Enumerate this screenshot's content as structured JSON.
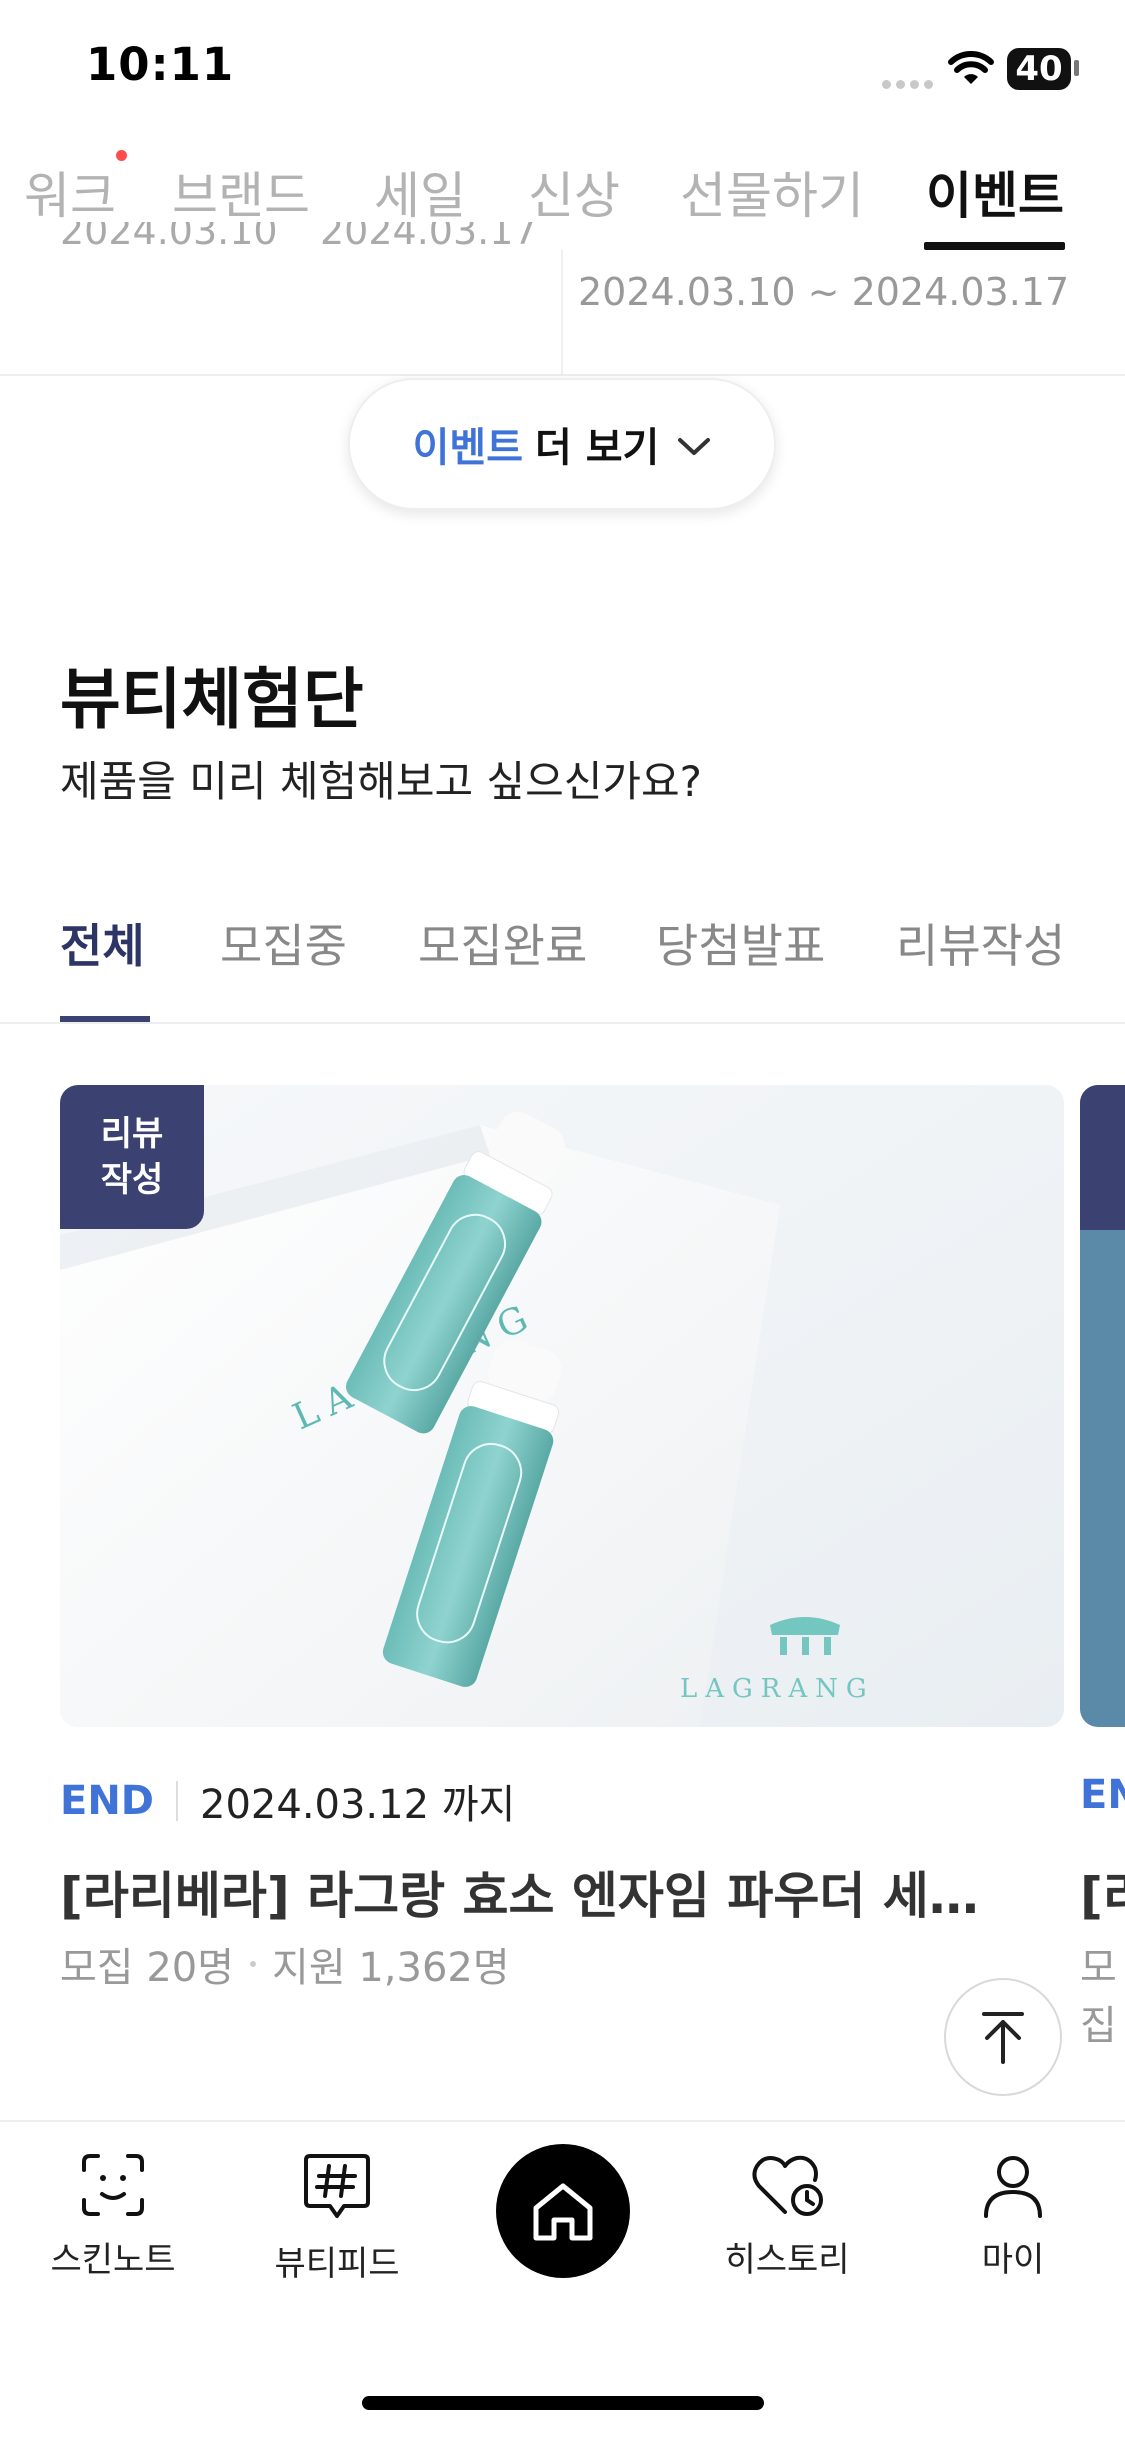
{
  "status_bar": {
    "time": "10:11",
    "battery": "40"
  },
  "category_nav": {
    "items": [
      "워크",
      "브랜드",
      "세일",
      "신상",
      "선물하기",
      "이벤트"
    ],
    "active": "이벤트"
  },
  "event_strip": {
    "cut_dates": [
      "2024.03.10",
      "2024.03.17"
    ],
    "date_range": "2024.03.10 ~  2024.03.17",
    "more_button": {
      "highlight": "이벤트",
      "rest": "더 보기"
    }
  },
  "beauty_trial": {
    "title": "뷰티체험단",
    "subtitle": "제품을 미리 체험해보고 싶으신가요?",
    "tabs": [
      "전체",
      "모집중",
      "모집완료",
      "당첨발표",
      "리뷰작성"
    ],
    "active_tab": "전체"
  },
  "card": {
    "badge_line1": "리뷰",
    "badge_line2": "작성",
    "status": "END",
    "deadline": "2024.03.12 까지",
    "title": "[라리베라] 라그랑 효소 엔자임 파우더 세…",
    "recruit": "모집 20명",
    "applicants": "지원 1,362명",
    "image_text": {
      "brand": "LAGRANG"
    }
  },
  "card_peek": {
    "status": "EN",
    "title": "[리",
    "stats": "모집"
  },
  "bottom_nav": {
    "items": [
      {
        "label": "스킨노트",
        "icon": "face-scan-icon"
      },
      {
        "label": "뷰티피드",
        "icon": "hashtag-chat-icon"
      },
      {
        "label": "",
        "icon": "home-icon"
      },
      {
        "label": "히스토리",
        "icon": "heart-history-icon"
      },
      {
        "label": "마이",
        "icon": "person-icon"
      }
    ]
  },
  "colors": {
    "accent_blue": "#3f73d8",
    "navy": "#3b4272",
    "mint": "#7cc8c4"
  }
}
